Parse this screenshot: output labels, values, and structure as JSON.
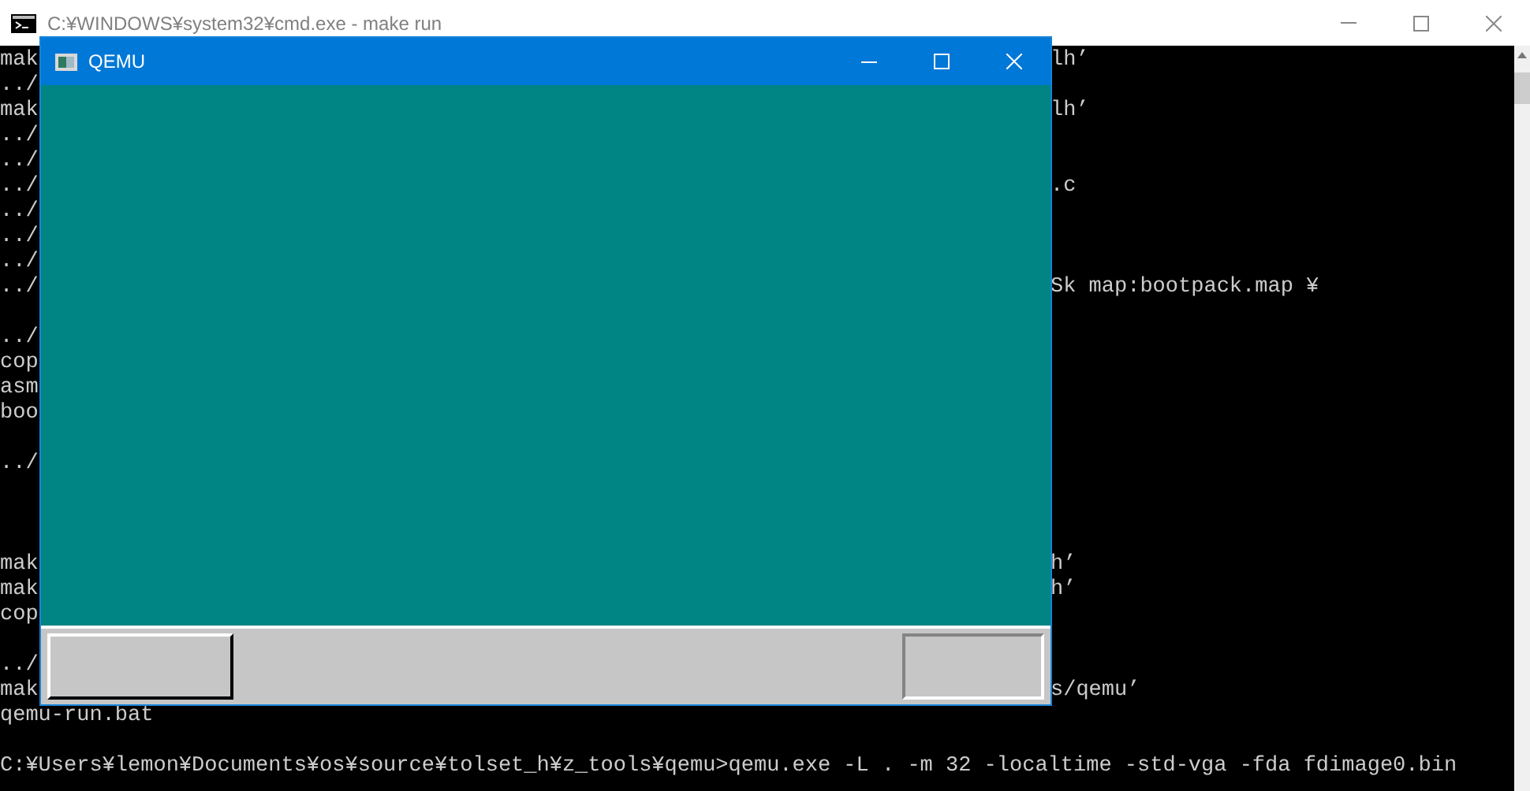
{
  "console_window": {
    "title": "C:¥WINDOWS¥system32¥cmd.exe - make  run"
  },
  "console": {
    "lines": [
      {
        "kind": "split",
        "left": "mak",
        "right": "lh’"
      },
      {
        "kind": "split",
        "left": "../"
      },
      {
        "kind": "split",
        "left": "mak",
        "right": "lh’"
      },
      {
        "kind": "split",
        "left": "../"
      },
      {
        "kind": "split",
        "left": "../"
      },
      {
        "kind": "split",
        "left": "../",
        "right": ".c"
      },
      {
        "kind": "split",
        "left": "../"
      },
      {
        "kind": "split",
        "left": "../"
      },
      {
        "kind": "split",
        "left": "../"
      },
      {
        "kind": "split",
        "left": "../",
        "right": "Sk map:bootpack.map ¥"
      },
      {
        "kind": "blank"
      },
      {
        "kind": "split",
        "left": "../"
      },
      {
        "kind": "split",
        "left": "cop"
      },
      {
        "kind": "split",
        "left": "asm"
      },
      {
        "kind": "split",
        "left": "boo"
      },
      {
        "kind": "blank"
      },
      {
        "kind": "split",
        "left": "../"
      },
      {
        "kind": "blank"
      },
      {
        "kind": "blank"
      },
      {
        "kind": "blank"
      },
      {
        "kind": "split",
        "left": "mak",
        "right": "h’"
      },
      {
        "kind": "split",
        "left": "mak",
        "right": "h’"
      },
      {
        "kind": "split",
        "left": "cop"
      },
      {
        "kind": "blank"
      },
      {
        "kind": "split",
        "left": "../"
      },
      {
        "kind": "split",
        "left": "mak",
        "right": "s/qemu’"
      },
      {
        "kind": "full",
        "text": "qemu-run.bat"
      },
      {
        "kind": "blank"
      },
      {
        "kind": "full",
        "text": "C:¥Users¥lemon¥Documents¥os¥source¥tolset_h¥z_tools¥qemu>qemu.exe -L . -m 32 -localtime -std-vga -fda fdimage0.bin"
      }
    ]
  },
  "qemu_window": {
    "title": "QEMU"
  }
}
